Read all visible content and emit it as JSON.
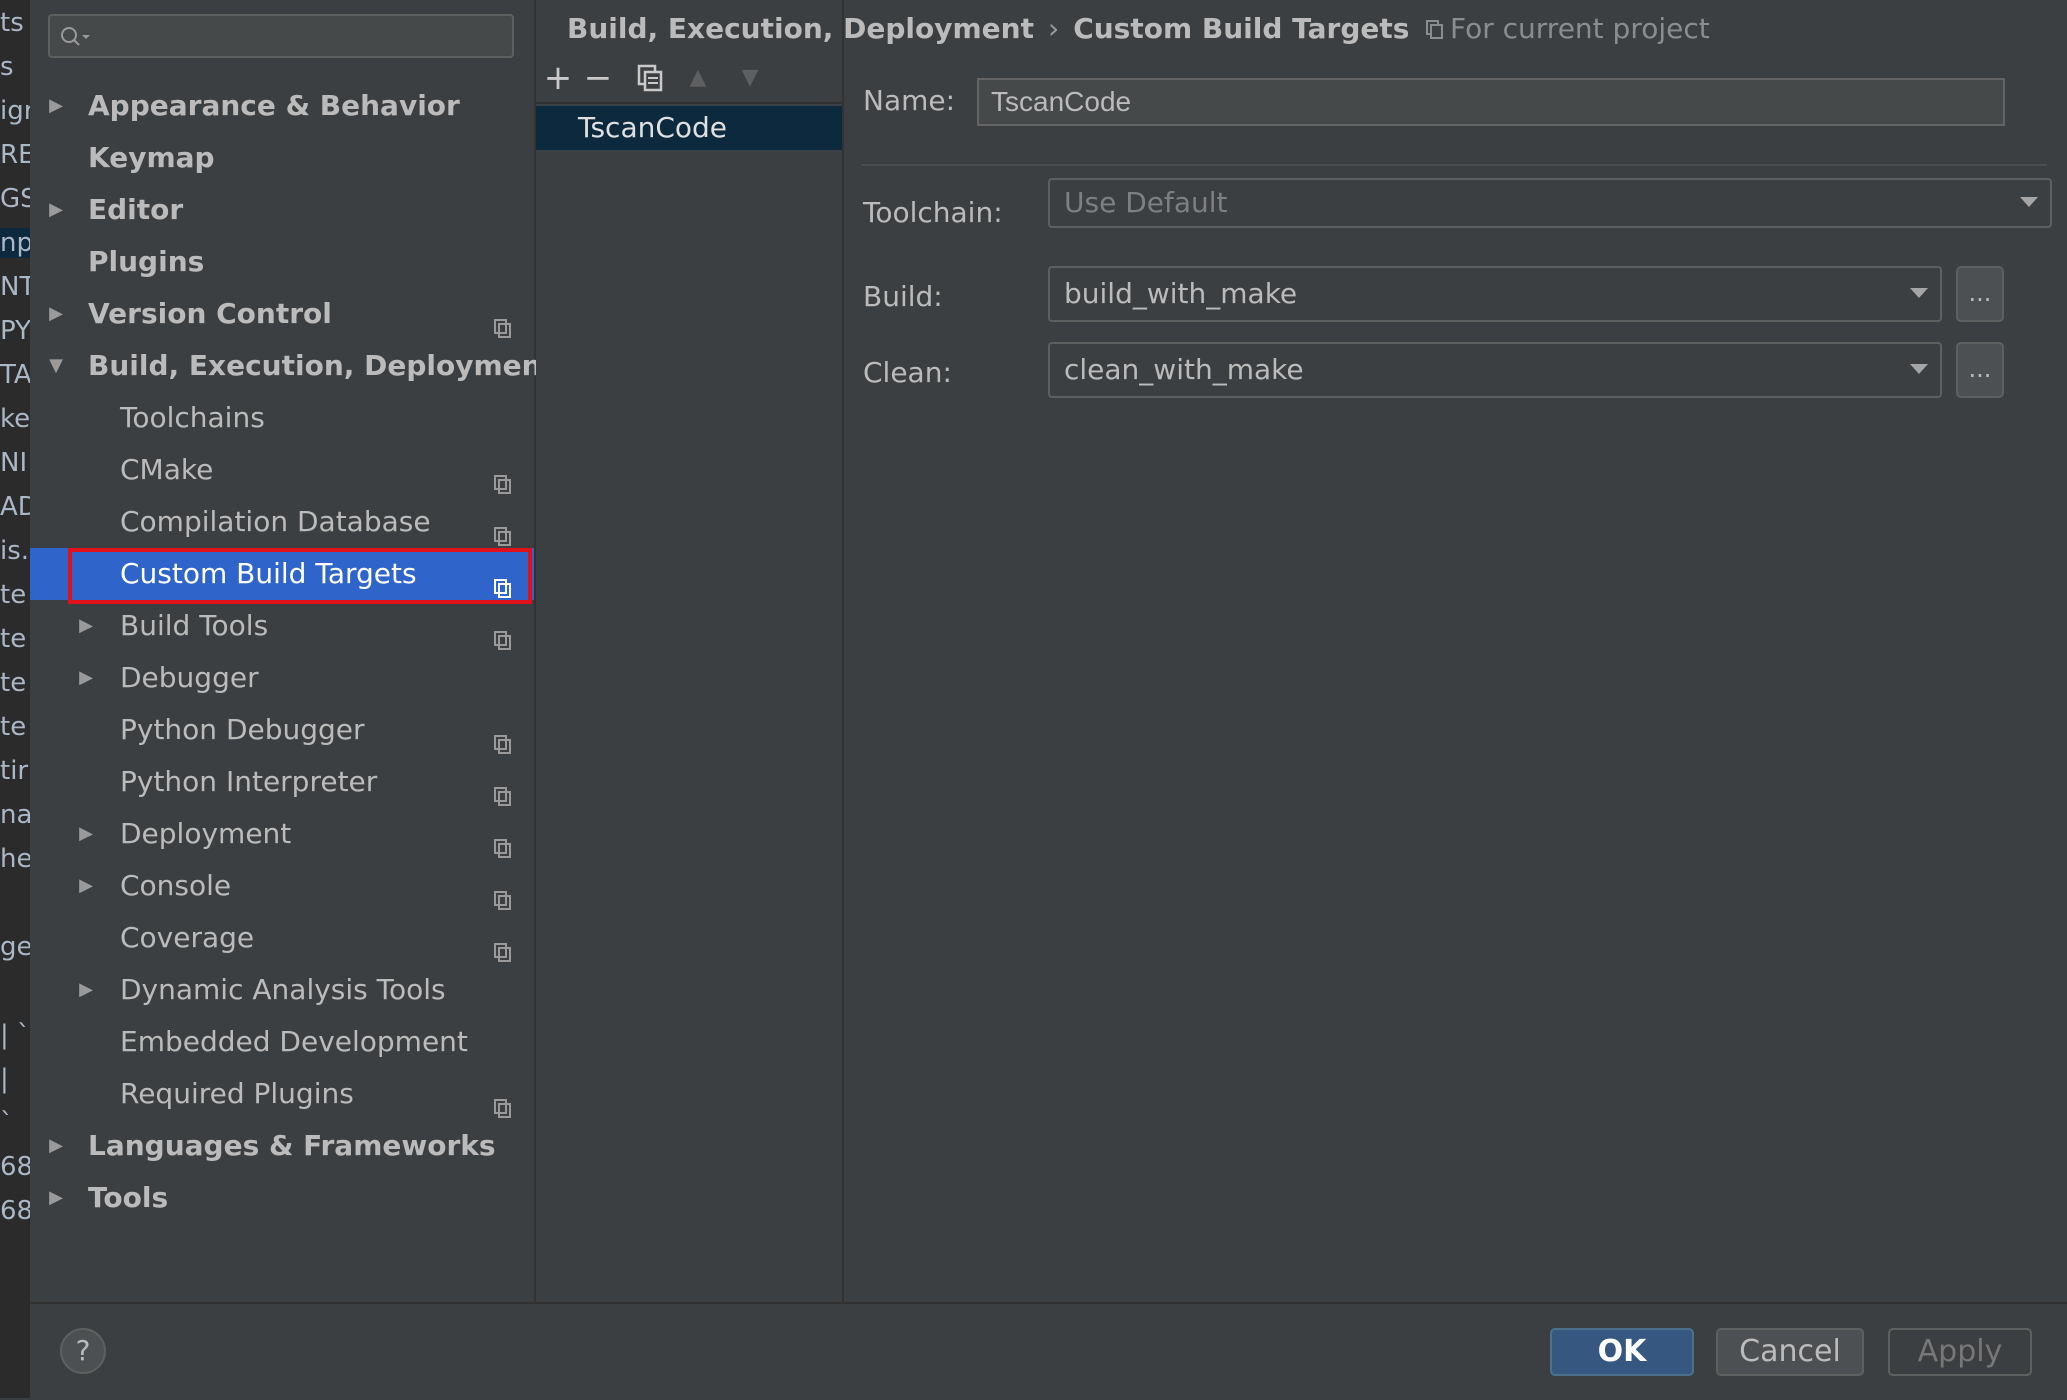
{
  "background_editor": {
    "lines": [
      "ts",
      "s",
      "igr",
      "RE",
      "GS",
      "np",
      "NT",
      "PY",
      "TA",
      "ke",
      "NI",
      "AD",
      "is.",
      "te",
      "te",
      "te",
      "te",
      "tir",
      "nal",
      "he",
      "",
      "ge",
      "",
      "| `",
      "|",
      "`",
      "68",
      "68"
    ]
  },
  "search": {
    "placeholder": "",
    "value": ""
  },
  "tree": {
    "items": [
      {
        "label": "Appearance & Behavior",
        "expandable": true,
        "expanded": false,
        "level": 0,
        "project_icon": false
      },
      {
        "label": "Keymap",
        "expandable": false,
        "level": 0,
        "project_icon": false
      },
      {
        "label": "Editor",
        "expandable": true,
        "expanded": false,
        "level": 0,
        "project_icon": false
      },
      {
        "label": "Plugins",
        "expandable": false,
        "level": 0,
        "project_icon": false
      },
      {
        "label": "Version Control",
        "expandable": true,
        "expanded": false,
        "level": 0,
        "project_icon": true
      },
      {
        "label": "Build, Execution, Deployment",
        "expandable": true,
        "expanded": true,
        "level": 0,
        "project_icon": false
      },
      {
        "label": "Toolchains",
        "expandable": false,
        "level": 1,
        "project_icon": false
      },
      {
        "label": "CMake",
        "expandable": false,
        "level": 1,
        "project_icon": true
      },
      {
        "label": "Compilation Database",
        "expandable": false,
        "level": 1,
        "project_icon": true
      },
      {
        "label": "Custom Build Targets",
        "expandable": false,
        "level": 1,
        "project_icon": true,
        "selected": true
      },
      {
        "label": "Build Tools",
        "expandable": true,
        "expanded": false,
        "level": 1,
        "project_icon": true
      },
      {
        "label": "Debugger",
        "expandable": true,
        "expanded": false,
        "level": 1,
        "project_icon": false
      },
      {
        "label": "Python Debugger",
        "expandable": false,
        "level": 1,
        "project_icon": true
      },
      {
        "label": "Python Interpreter",
        "expandable": false,
        "level": 1,
        "project_icon": true
      },
      {
        "label": "Deployment",
        "expandable": true,
        "expanded": false,
        "level": 1,
        "project_icon": true
      },
      {
        "label": "Console",
        "expandable": true,
        "expanded": false,
        "level": 1,
        "project_icon": true
      },
      {
        "label": "Coverage",
        "expandable": false,
        "level": 1,
        "project_icon": true
      },
      {
        "label": "Dynamic Analysis Tools",
        "expandable": true,
        "expanded": false,
        "level": 1,
        "project_icon": false
      },
      {
        "label": "Embedded Development",
        "expandable": false,
        "level": 1,
        "project_icon": false
      },
      {
        "label": "Required Plugins",
        "expandable": false,
        "level": 1,
        "project_icon": true
      },
      {
        "label": "Languages & Frameworks",
        "expandable": true,
        "expanded": false,
        "level": 0,
        "project_icon": false
      },
      {
        "label": "Tools",
        "expandable": true,
        "expanded": false,
        "level": 0,
        "project_icon": false
      }
    ]
  },
  "breadcrumb": {
    "parent": "Build, Execution, Deployment",
    "separator": "›",
    "current": "Custom Build Targets",
    "scope": "For current project"
  },
  "targets_toolbar": {
    "add": "+",
    "remove": "−",
    "copy_icon": "copy-icon",
    "up": "▲",
    "down": "▼"
  },
  "targets": [
    {
      "label": "TscanCode",
      "selected": true
    }
  ],
  "form": {
    "name_label": "Name:",
    "name_value": "TscanCode",
    "toolchain_label": "Toolchain:",
    "toolchain_value": "Use Default",
    "build_label": "Build:",
    "build_value": "build_with_make",
    "clean_label": "Clean:",
    "clean_value": "clean_with_make",
    "ellipsis": "..."
  },
  "buttons": {
    "help": "?",
    "ok": "OK",
    "cancel": "Cancel",
    "apply": "Apply"
  },
  "colors": {
    "selection": "#2f65ca",
    "highlight_box": "#e0111b",
    "ok_button": "#365880",
    "background": "#3c3f41"
  }
}
